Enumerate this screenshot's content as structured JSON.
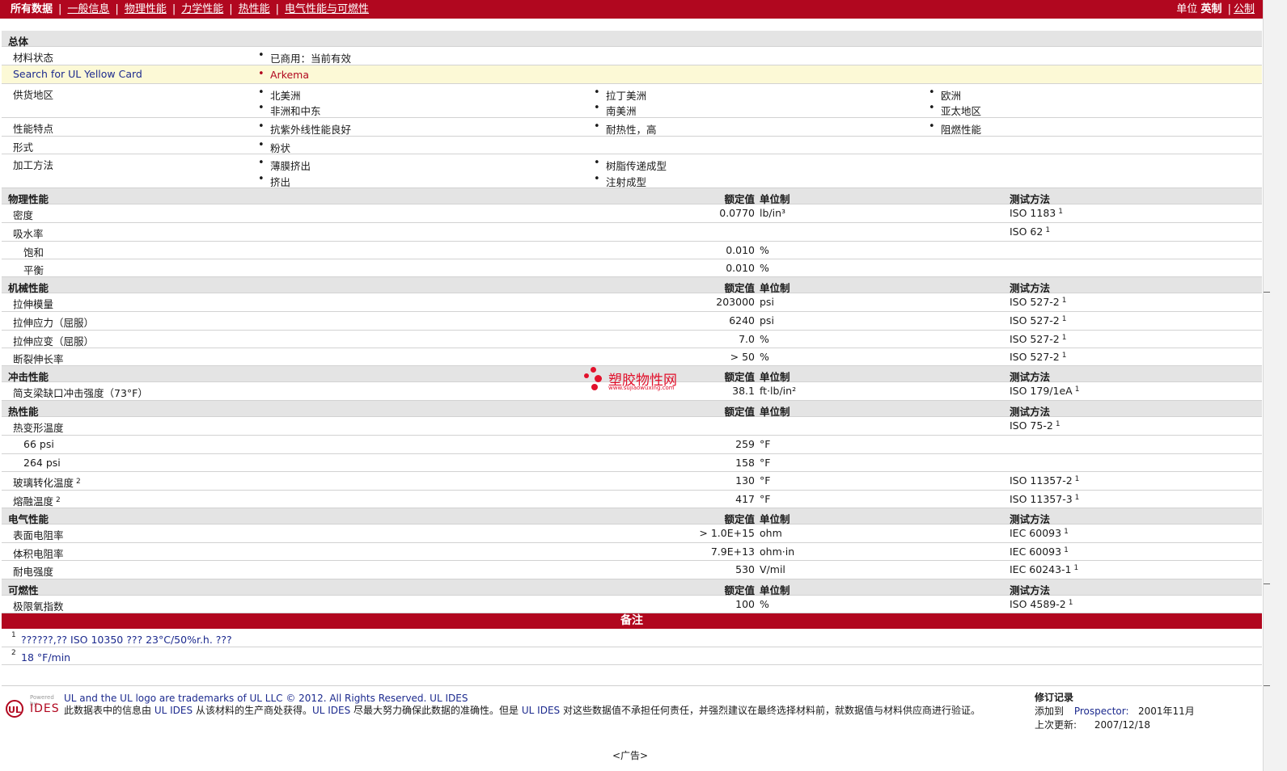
{
  "nav": {
    "items": [
      "所有数据",
      "一般信息",
      "物理性能",
      "力学性能",
      "热性能",
      "电气性能与可燃性"
    ],
    "units_label": "单位",
    "unit_imperial": "英制",
    "unit_metric": "公制"
  },
  "general": {
    "title": "总体",
    "material_status_label": "材料状态",
    "material_status_value": "已商用：当前有效",
    "ul_label": "Search for UL Yellow Card",
    "ul_value": "Arkema",
    "supply_label": "供货地区",
    "supply": [
      "北美洲",
      "拉丁美洲",
      "欧洲",
      "非洲和中东",
      "南美洲",
      "亚太地区"
    ],
    "features_label": "性能特点",
    "features": [
      "抗紫外线性能良好",
      "耐热性，高",
      "阻燃性能"
    ],
    "form_label": "形式",
    "form_value": "粉状",
    "process_label": "加工方法",
    "process": [
      "薄膜挤出",
      "树脂传递成型",
      "挤出",
      "注射成型"
    ]
  },
  "headers": {
    "value": "额定值",
    "unit": "单位制",
    "method": "测试方法"
  },
  "physical": {
    "title": "物理性能",
    "rows": [
      {
        "label": "密度",
        "value": "0.0770",
        "unit": "lb/in³",
        "method": "ISO 1183",
        "note": "1"
      },
      {
        "label": "吸水率",
        "value": "",
        "unit": "",
        "method": "ISO 62",
        "note": "1"
      },
      {
        "label": "饱和",
        "value": "0.010",
        "unit": "%",
        "method": "",
        "note": ""
      },
      {
        "label": "平衡",
        "value": "0.010",
        "unit": "%",
        "method": "",
        "note": ""
      }
    ]
  },
  "mechanical": {
    "title": "机械性能",
    "rows": [
      {
        "label": "拉伸模量",
        "value": "203000",
        "unit": "psi",
        "method": "ISO 527-2",
        "note": "1"
      },
      {
        "label": "拉伸应力（屈服）",
        "value": "6240",
        "unit": "psi",
        "method": "ISO 527-2",
        "note": "1"
      },
      {
        "label": "拉伸应变（屈服）",
        "value": "7.0",
        "unit": "%",
        "method": "ISO 527-2",
        "note": "1"
      },
      {
        "label": "断裂伸长率",
        "value": "> 50",
        "unit": "%",
        "method": "ISO 527-2",
        "note": "1"
      }
    ]
  },
  "impact": {
    "title": "冲击性能",
    "rows": [
      {
        "label": "简支梁缺口冲击强度（73°F）",
        "value": "38.1",
        "unit": "ft·lb/in²",
        "method": "ISO 179/1eA",
        "note": "1"
      }
    ]
  },
  "thermal": {
    "title": "热性能",
    "rows": [
      {
        "label": "热变形温度",
        "value": "",
        "unit": "",
        "method": "ISO 75-2",
        "note": "1",
        "lnote": ""
      },
      {
        "label": "66 psi",
        "value": "259",
        "unit": "°F",
        "method": "",
        "note": "",
        "lnote": ""
      },
      {
        "label": "264 psi",
        "value": "158",
        "unit": "°F",
        "method": "",
        "note": "",
        "lnote": ""
      },
      {
        "label": "玻璃转化温度",
        "value": "130",
        "unit": "°F",
        "method": "ISO 11357-2",
        "note": "1",
        "lnote": "2"
      },
      {
        "label": "熔融温度",
        "value": "417",
        "unit": "°F",
        "method": "ISO 11357-3",
        "note": "1",
        "lnote": "2"
      }
    ]
  },
  "electrical": {
    "title": "电气性能",
    "rows": [
      {
        "label": "表面电阻率",
        "value": "> 1.0E+15",
        "unit": "ohm",
        "method": "IEC 60093",
        "note": "1"
      },
      {
        "label": "体积电阻率",
        "value": "7.9E+13",
        "unit": "ohm·in",
        "method": "IEC 60093",
        "note": "1"
      },
      {
        "label": "耐电强度",
        "value": "530",
        "unit": "V/mil",
        "method": "IEC 60243-1",
        "note": "1"
      }
    ]
  },
  "flammability": {
    "title": "可燃性",
    "rows": [
      {
        "label": "极限氧指数",
        "value": "100",
        "unit": "%",
        "method": "ISO 4589-2",
        "note": "1"
      }
    ]
  },
  "notes": {
    "title": "备注",
    "items": [
      {
        "n": "1",
        "text": "??????,?? ISO 10350 ??? 23°C/50%r.h. ???"
      },
      {
        "n": "2",
        "text": "18 °F/min"
      }
    ]
  },
  "footer": {
    "logo_powered": "Powered by",
    "logo_ul": "UL",
    "logo_ides": "IDES",
    "trademark": "UL and the UL logo are trademarks of UL LLC © 2012. All Rights Reserved. UL IDES",
    "disclaimer_1": "此数据表中的信息由",
    "disclaimer_ul1": "UL IDES",
    "disclaimer_2": "从该材料的生产商处获得。",
    "disclaimer_ul2": "UL IDES",
    "disclaimer_3": "尽最大努力确保此数据的准确性。但是",
    "disclaimer_ul3": "UL IDES",
    "disclaimer_4": "对这些数据值不承担任何责任，并强烈建议在最终选择材料前，就数据值与材料供应商进行验证。",
    "revision_title": "修订记录",
    "added_label": "添加到",
    "added_where": "Prospector:",
    "added_date": "2001年11月",
    "updated_label": "上次更新:",
    "updated_date": "2007/12/18",
    "ad": "<广告>"
  },
  "watermark": {
    "cn": "塑胶物性网",
    "url": "www.sujiaowuxing.com"
  },
  "colors": {
    "brand_red": "#b1071f",
    "section_gray": "#e4e4e4",
    "highlight_yellow": "#fcf9d6"
  }
}
